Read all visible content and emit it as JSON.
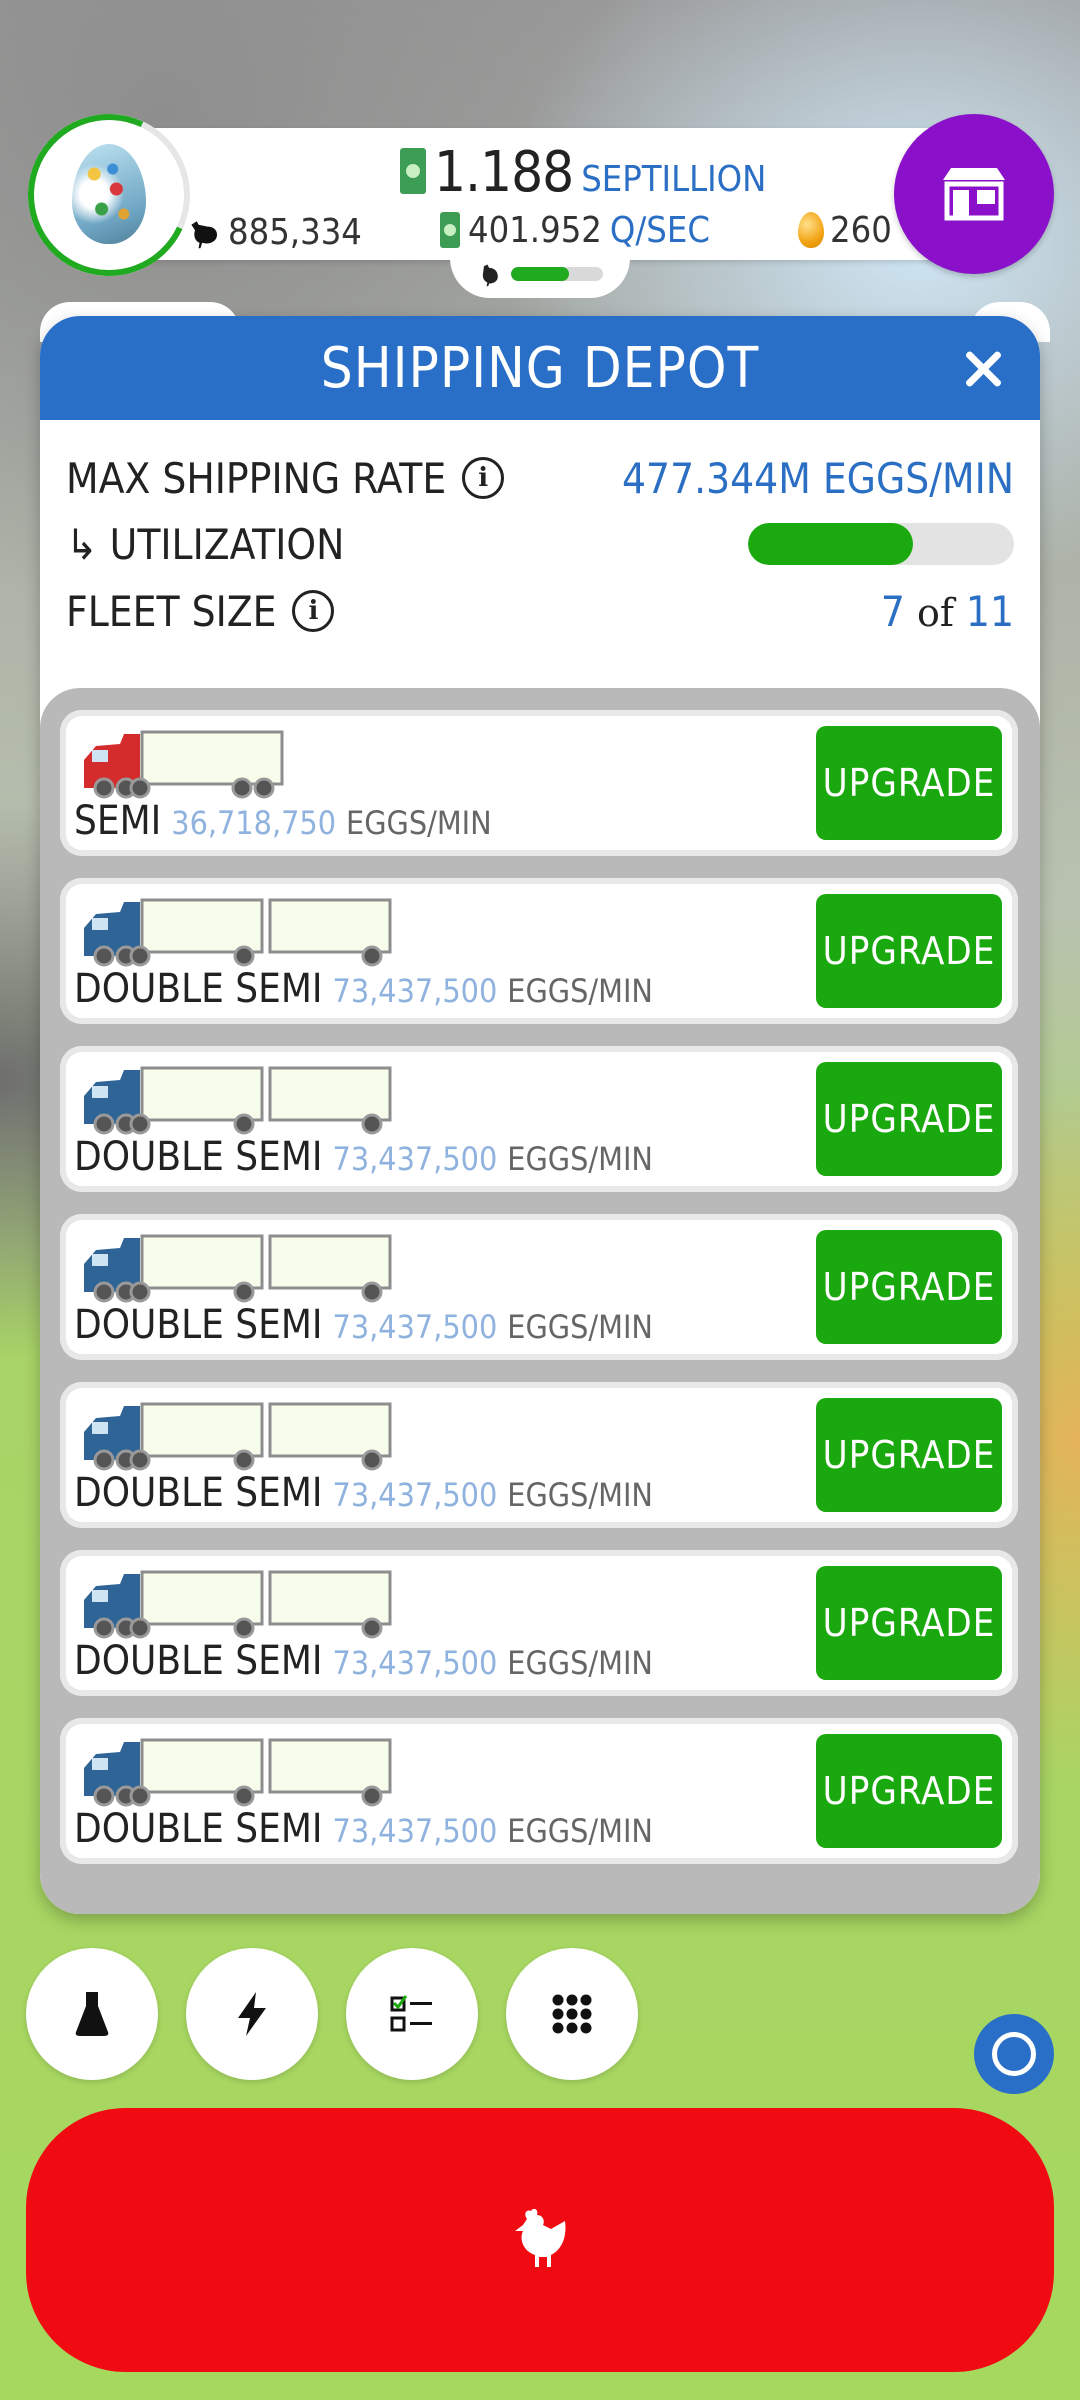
{
  "hud": {
    "chicken_count": "885,334",
    "money_value": "1.188",
    "money_unit": "SEPTILLION",
    "rate_value": "401.952",
    "rate_unit": "Q/SEC",
    "golden_eggs": "260",
    "habitat_fill_percent": 63
  },
  "dialog": {
    "title": "SHIPPING DEPOT",
    "max_shipping_rate_label": "MAX SHIPPING RATE",
    "max_shipping_rate_value": "477.344M EGGS/MIN",
    "utilization_label": "↳ UTILIZATION",
    "utilization_percent": 62,
    "fleet_size_label": "FLEET SIZE",
    "fleet_size_current": "7",
    "fleet_size_of": "of",
    "fleet_size_max": "11"
  },
  "vehicles": [
    {
      "name": "SEMI",
      "rate": "36,718,750",
      "unit": "EGGS/MIN",
      "button": "UPGRADE",
      "type": "semi",
      "cab_color": "#d42c2c"
    },
    {
      "name": "DOUBLE SEMI",
      "rate": "73,437,500",
      "unit": "EGGS/MIN",
      "button": "UPGRADE",
      "type": "double",
      "cab_color": "#2f6496"
    },
    {
      "name": "DOUBLE SEMI",
      "rate": "73,437,500",
      "unit": "EGGS/MIN",
      "button": "UPGRADE",
      "type": "double",
      "cab_color": "#2f6496"
    },
    {
      "name": "DOUBLE SEMI",
      "rate": "73,437,500",
      "unit": "EGGS/MIN",
      "button": "UPGRADE",
      "type": "double",
      "cab_color": "#2f6496"
    },
    {
      "name": "DOUBLE SEMI",
      "rate": "73,437,500",
      "unit": "EGGS/MIN",
      "button": "UPGRADE",
      "type": "double",
      "cab_color": "#2f6496"
    },
    {
      "name": "DOUBLE SEMI",
      "rate": "73,437,500",
      "unit": "EGGS/MIN",
      "button": "UPGRADE",
      "type": "double",
      "cab_color": "#2f6496"
    },
    {
      "name": "DOUBLE SEMI",
      "rate": "73,437,500",
      "unit": "EGGS/MIN",
      "button": "UPGRADE",
      "type": "double",
      "cab_color": "#2f6496"
    }
  ],
  "toolbar": {
    "buttons": [
      "flask-icon",
      "lightning-icon",
      "checklist-icon",
      "grid-icon"
    ]
  },
  "colors": {
    "header_blue": "#2a6fc7",
    "upgrade_green": "#1aa80f",
    "hatch_red": "#ef0b11",
    "shop_purple": "#8a10c9",
    "value_blue": "#2b6fc4"
  }
}
